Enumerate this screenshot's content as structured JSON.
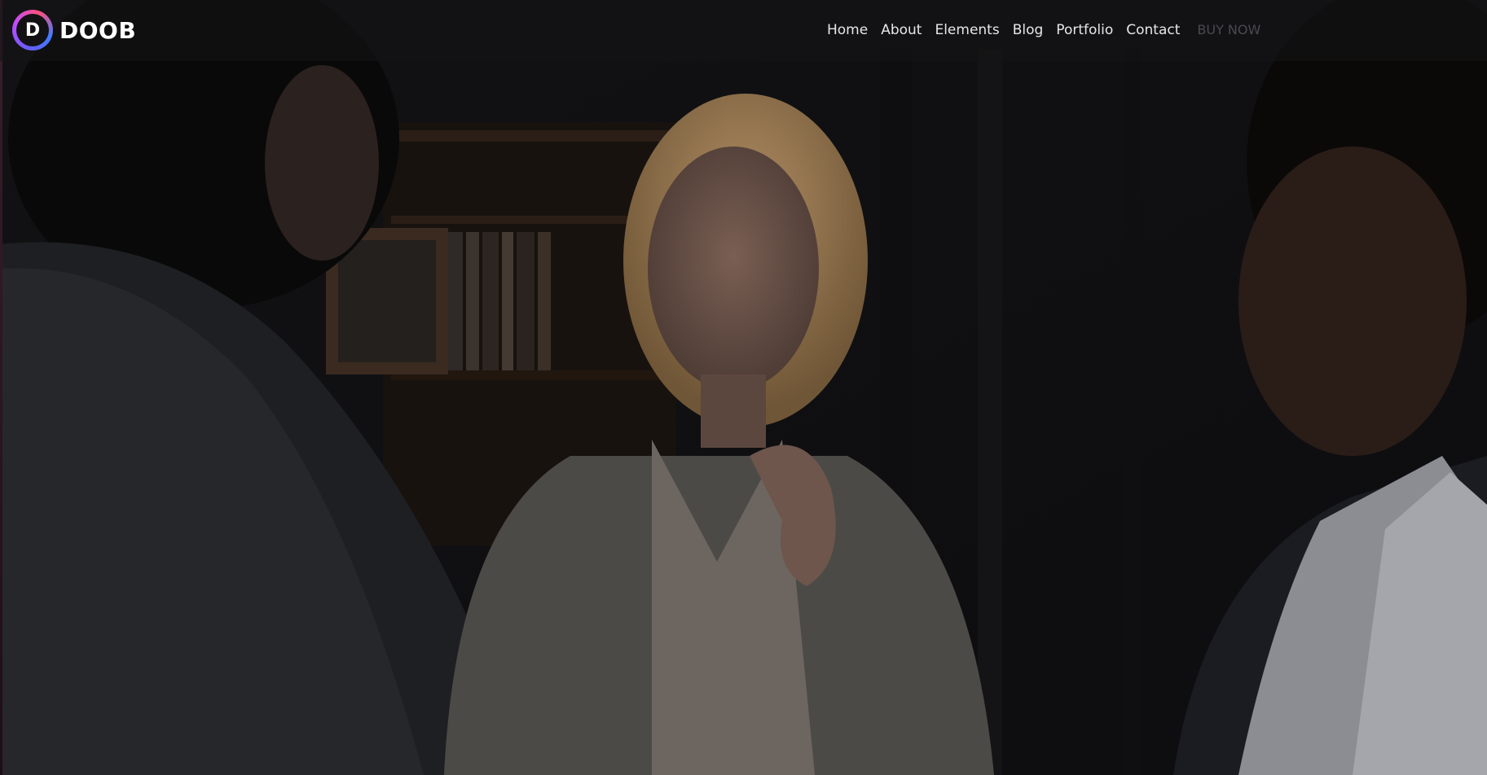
{
  "brand": {
    "mark": "D",
    "name": "DOOB"
  },
  "nav": {
    "items": [
      "Home",
      "About",
      "Elements",
      "Blog",
      "Portfolio",
      "Contact"
    ],
    "cta": "BUY NOW"
  },
  "colors": {
    "header_overlay": "#141416",
    "nav_text": "#e7e7ea",
    "cta_text": "#4a4a4f",
    "logo_gradient": [
      "#6b5bff",
      "#c14cff",
      "#ff4f7d",
      "#3f7bff"
    ]
  }
}
